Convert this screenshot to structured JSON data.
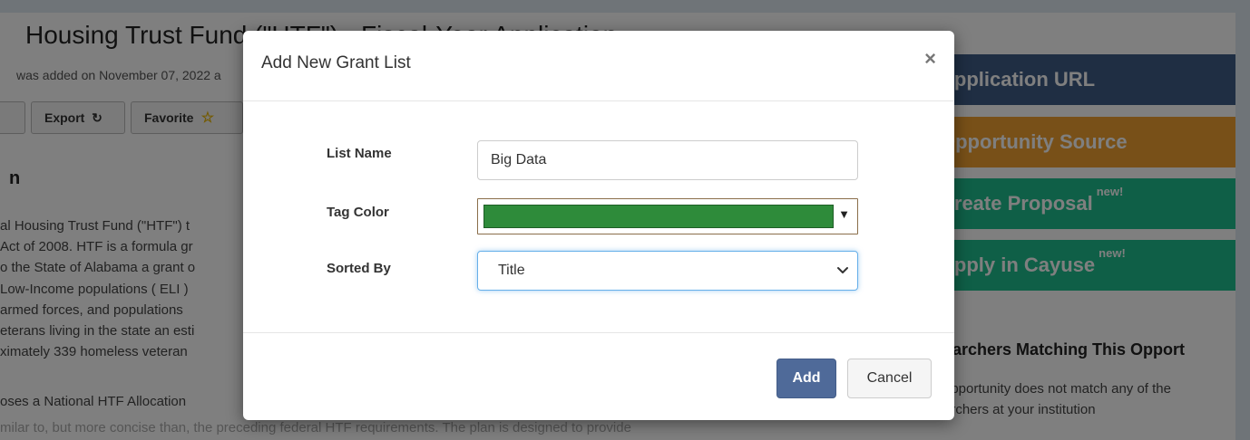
{
  "background": {
    "title": "Housing Trust Fund (\"HTF\") - Fiscal-Year Application",
    "added": "was added on November 07, 2022 a",
    "export_label": "Export",
    "favorite_label": "Favorite",
    "section_heading": "n",
    "paragraph1": [
      "al Housing Trust Fund (\"HTF\") t",
      "Act of 2008. HTF is a formula gr",
      "o the State of Alabama a grant o",
      "Low-Income populations ( ELI )",
      "armed forces, and populations",
      "eterans living in the state an esti",
      "ximately 339 homeless veteran"
    ],
    "paragraph2": "oses a National HTF Allocation",
    "faded": "milar to, but more concise than, the preceding federal HTF requirements. The plan is designed to provide",
    "sidebar": {
      "application_url": "Application URL",
      "opportunity_source": "Opportunity Source",
      "create_proposal": "Create Proposal",
      "apply_cayuse": "Apply in Cayuse",
      "new_badge": "new!",
      "researchers_heading": "earchers Matching This Opport",
      "researchers_text_1": "opportunity does not match any of the",
      "researchers_text_2": "archers at your institution"
    }
  },
  "modal": {
    "title": "Add New Grant List",
    "close_symbol": "×",
    "list_name_label": "List Name",
    "list_name_value": "Big Data",
    "tag_color_label": "Tag Color",
    "tag_color_value": "#2e8b3a",
    "sorted_by_label": "Sorted By",
    "sorted_by_value": "Title",
    "add_label": "Add",
    "cancel_label": "Cancel"
  }
}
